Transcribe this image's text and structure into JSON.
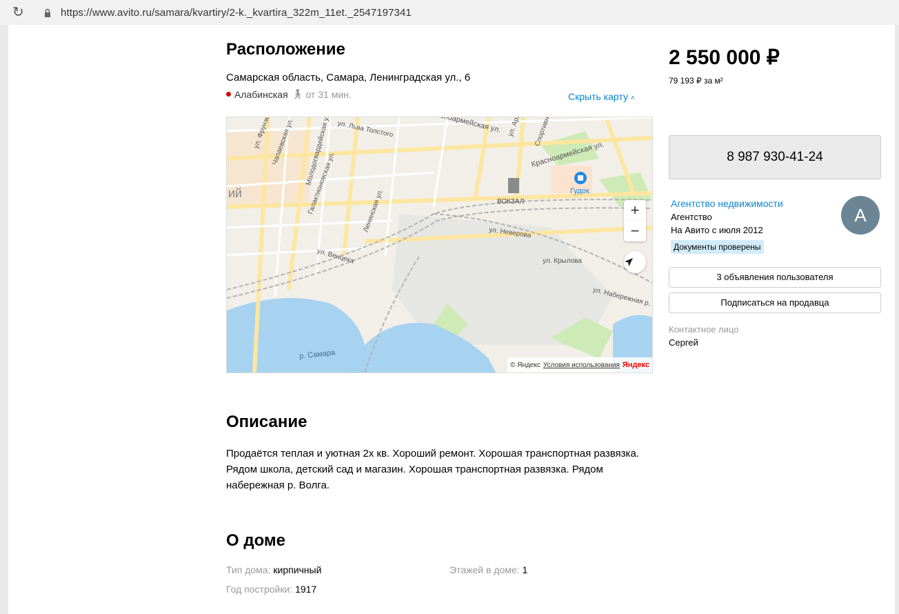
{
  "browser": {
    "url": "https://www.avito.ru/samara/kvartiry/2-k._kvartira_322m_11et._2547197341"
  },
  "location": {
    "title": "Расположение",
    "address": "Самарская область, Самара, Ленинградская ул., 6",
    "metro_station": "Алабинская",
    "walk_time": "от 31 мин.",
    "hide_map": "Скрыть карту",
    "metro_color": "#d80a0a"
  },
  "map": {
    "labels": {
      "lva_tolstogo": "ул. Льва Толстого",
      "krasnoarmeyskaya1": "Красноармейская ул.",
      "krasnoarmeyskaya2": "Красноармейская ул.",
      "frunze": "ул. Фрунзе",
      "chapaevskaya": "Чапаевская ул.",
      "molodogvardeyskaya": "Молодогвардейская ул.",
      "galaktionovskaya": "Галактионовская ул.",
      "leninskaya": "Ленинская ул.",
      "sportivnaya": "Спортивная",
      "arcybushevskaya": "ул. Арц",
      "venceka": "ул. Венцека",
      "neverova": "ул. Неверова",
      "krylova": "ул. Крылова",
      "naberezhnaya": "ул. Набережная р.",
      "vokzal": "ВОКЗАЛ",
      "gudok": "Гудок",
      "samara_river": "р. Самара",
      "iy": "ий"
    },
    "zoom_in": "+",
    "zoom_out": "−",
    "credit": "© Яндекс",
    "terms": "Условия использования",
    "logo": "Яндекс"
  },
  "description": {
    "title": "Описание",
    "text": "Продаётся теплая и уютная 2х кв. Хороший ремонт. Хорошая транспортная развязка. Рядом школа, детский сад и магазин. Хорошая транспортная развязка. Рядом набережная р. Волга."
  },
  "house": {
    "title": "О доме",
    "type_label": "Тип дома:",
    "type_value": "кирпичный",
    "floors_label": "Этажей в доме:",
    "floors_value": "1",
    "year_label": "Год постройки:",
    "year_value": "1917"
  },
  "sidebar": {
    "price": "2 550 000 ₽",
    "price_per_m2": "79 193 ₽ за м²",
    "phone": "8 987 930-41-24",
    "agency_name": "Агентство недвижимости",
    "agency_type": "Агентство",
    "on_avito_since": "На Авито с июля 2012",
    "docs_verified": "Документы проверены",
    "avatar_letter": "А",
    "user_ads_button": "3 объявления пользователя",
    "subscribe_button": "Подписаться на продавца",
    "contact_label": "Контактное лицо",
    "contact_name": "Сергей"
  }
}
